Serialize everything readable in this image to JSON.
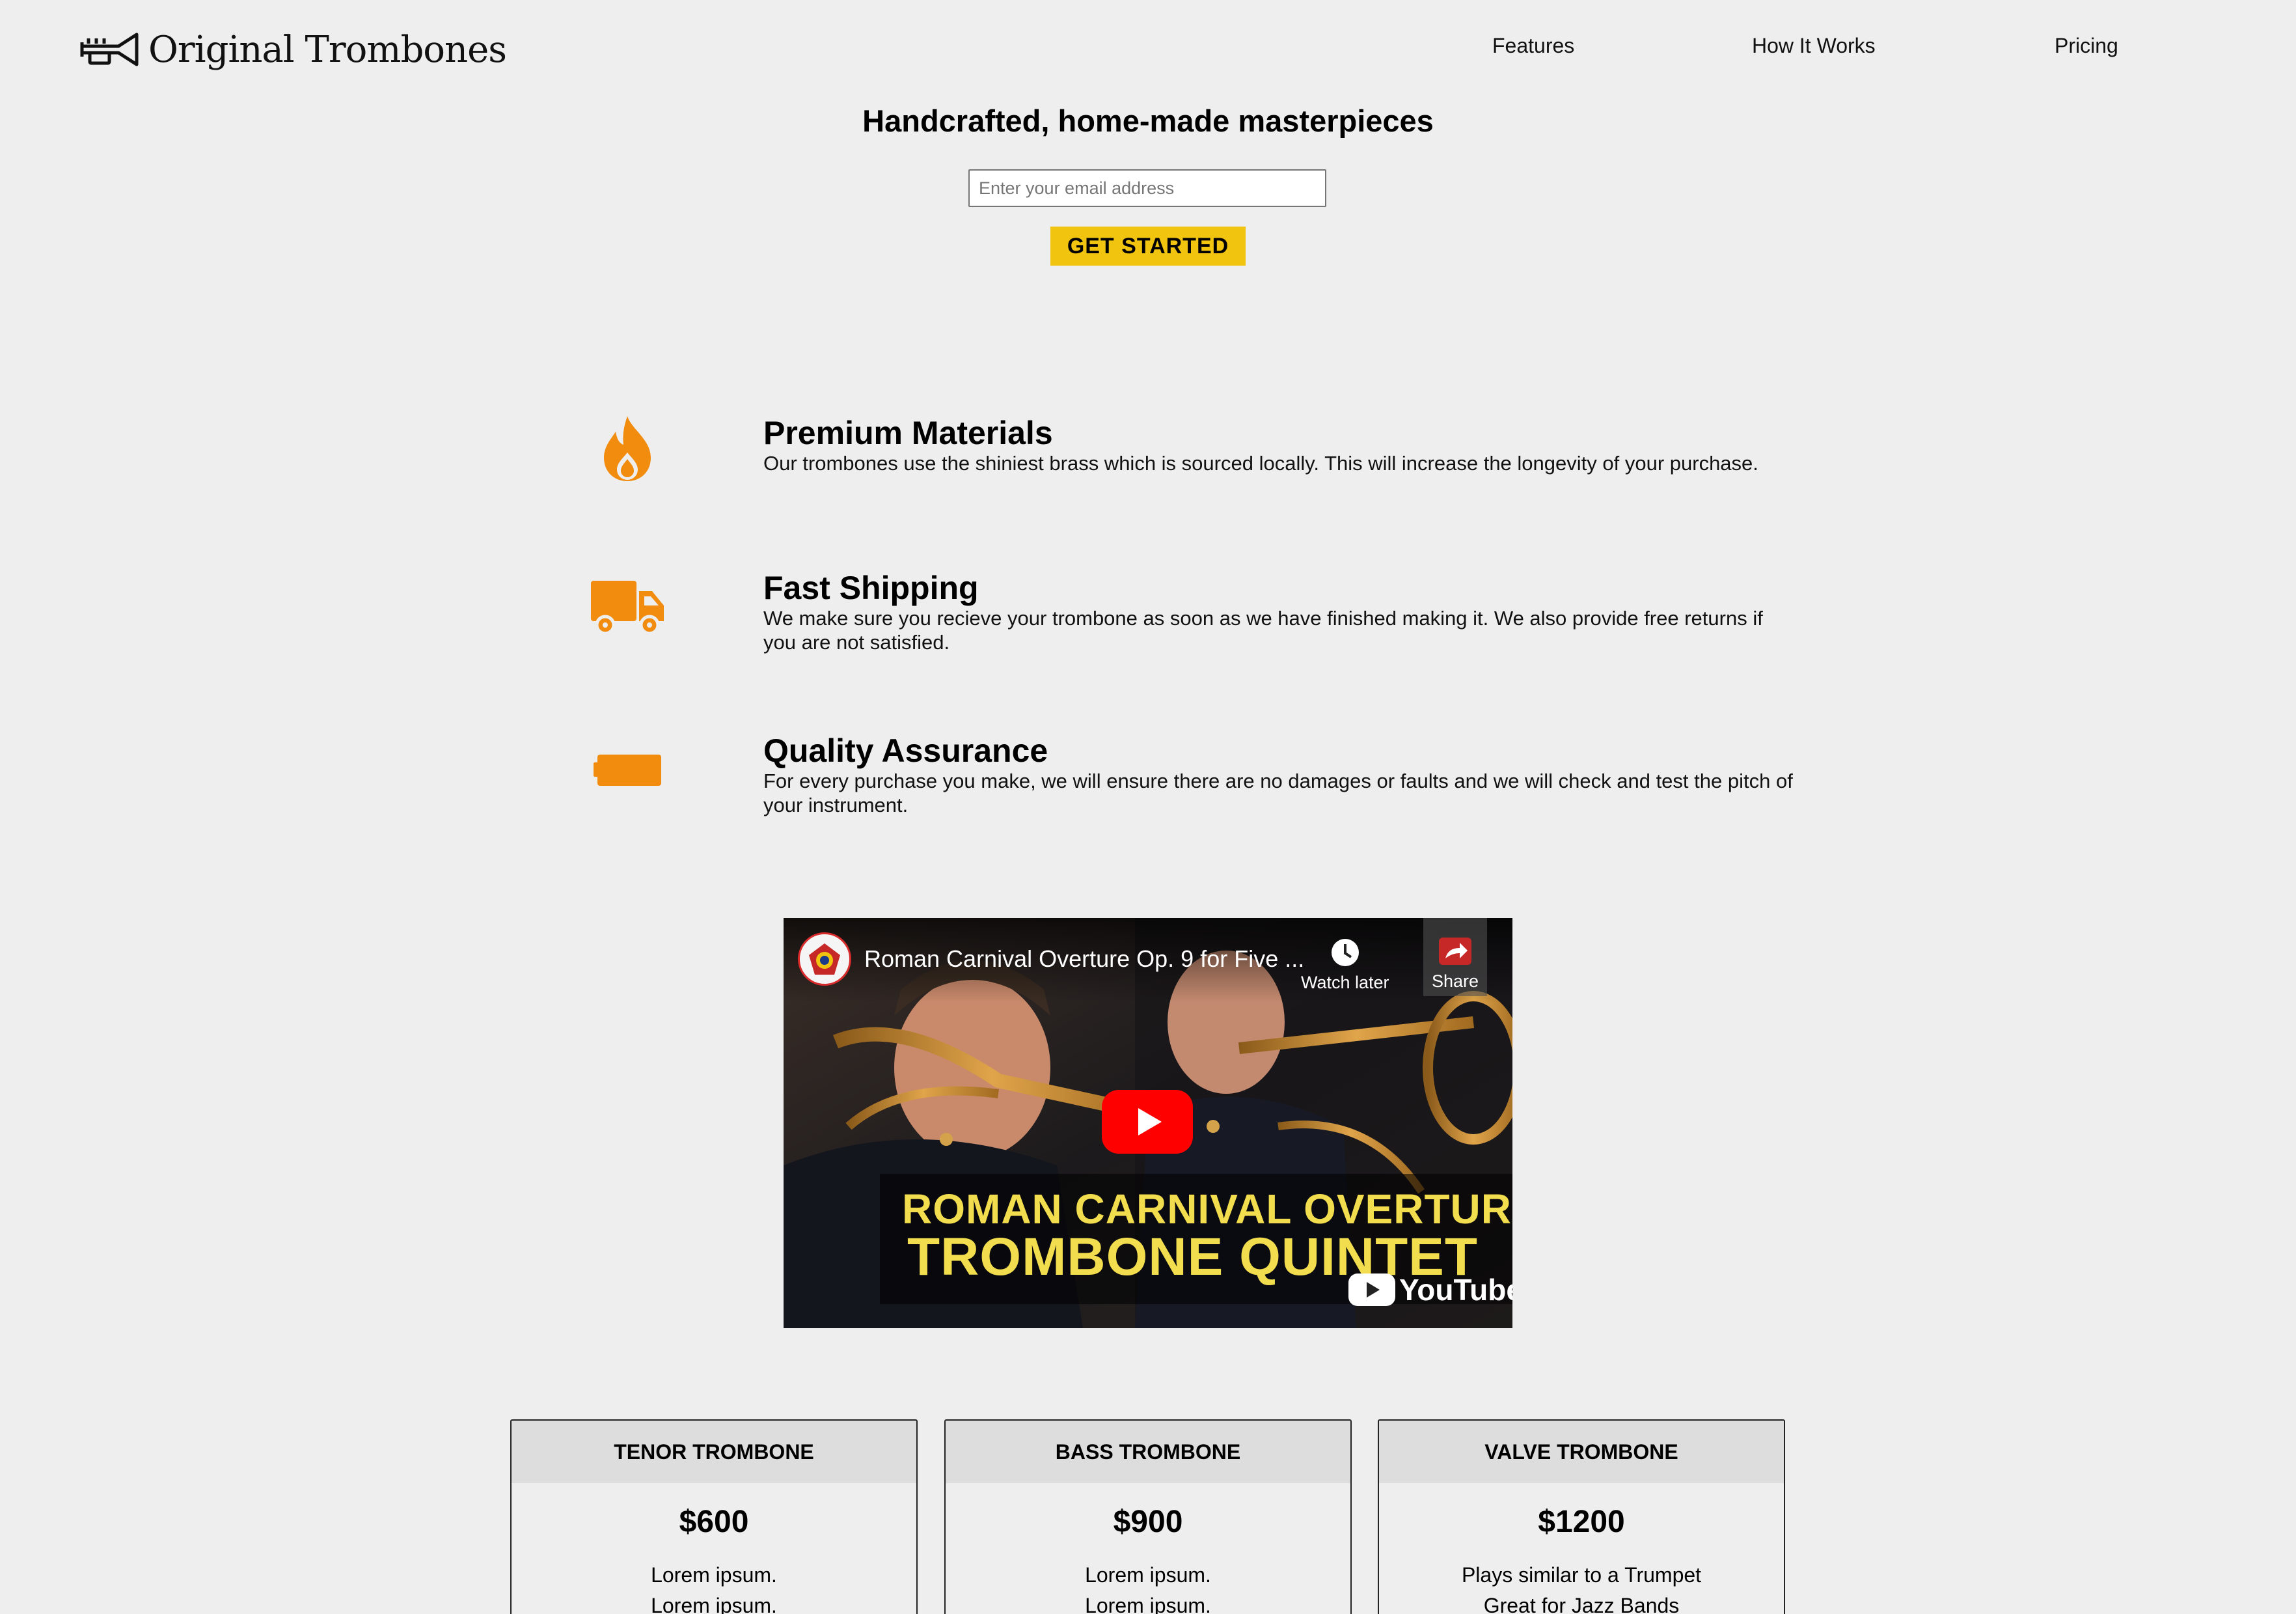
{
  "header": {
    "brand": "Original Trombones",
    "nav": [
      {
        "label": "Features"
      },
      {
        "label": "How It Works"
      },
      {
        "label": "Pricing"
      }
    ]
  },
  "hero": {
    "title": "Handcrafted, home-made masterpieces",
    "email_placeholder": "Enter your email address",
    "email_value": "",
    "cta_label": "GET STARTED"
  },
  "features": [
    {
      "icon": "fire-icon",
      "title": "Premium Materials",
      "description": "Our trombones use the shiniest brass which is sourced locally. This will increase the longevity of your purchase."
    },
    {
      "icon": "truck-icon",
      "title": "Fast Shipping",
      "description": "We make sure you recieve your trombone as soon as we have finished making it. We also provide free returns if you are not satisfied."
    },
    {
      "icon": "battery-icon",
      "title": "Quality Assurance",
      "description": "For every purchase you make, we will ensure there are no damages or faults and we will check and test the pitch of your instrument."
    }
  ],
  "video": {
    "title": "Roman Carnival Overture Op. 9 for Five ...",
    "watch_later_label": "Watch later",
    "share_label": "Share",
    "banner_line1": "ROMAN CARNIVAL OVERTURE",
    "banner_line2": "TROMBONE QUINTET",
    "platform_label": "YouTube"
  },
  "pricing": [
    {
      "name": "TENOR TROMBONE",
      "price": "$600",
      "line1": "Lorem ipsum.",
      "line2": "Lorem ipsum."
    },
    {
      "name": "BASS TROMBONE",
      "price": "$900",
      "line1": "Lorem ipsum.",
      "line2": "Lorem ipsum."
    },
    {
      "name": "VALVE TROMBONE",
      "price": "$1200",
      "line1": "Plays similar to a Trumpet",
      "line2": "Great for Jazz Bands"
    }
  ],
  "colors": {
    "background": "#eeeeee",
    "accent_orange": "#f28c0f",
    "cta_yellow": "#f1c40f",
    "banner_yellow": "#f2dd4f",
    "play_red": "#ff0000"
  }
}
